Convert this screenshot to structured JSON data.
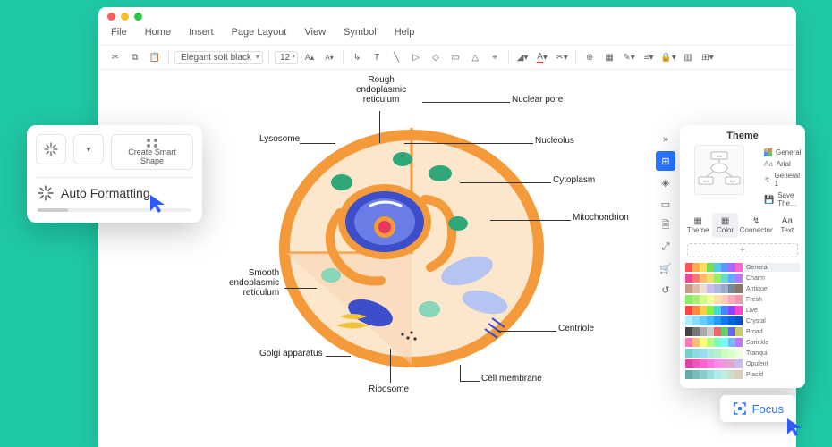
{
  "window": {
    "dots": [
      "#ff5f57",
      "#febc2e",
      "#28c840"
    ]
  },
  "menu": [
    "File",
    "Home",
    "Insert",
    "Page Layout",
    "View",
    "Symbol",
    "Help"
  ],
  "toolbar": {
    "font": "Elegant soft black",
    "size": "12"
  },
  "popover": {
    "create_smart_shape": "Create Smart\nShape",
    "auto_formatting": "Auto Formatting"
  },
  "theme": {
    "title": "Theme",
    "presets": [
      "General",
      "Arial",
      "General 1",
      "Save The…"
    ],
    "tabs": [
      "Theme",
      "Color",
      "Connector",
      "Text"
    ],
    "palettes": [
      "General",
      "Charm",
      "Antique",
      "Fresh",
      "Live",
      "Crystal",
      "Broad",
      "Sprinkle",
      "Tranquil",
      "Opulent",
      "Placid"
    ]
  },
  "labels": {
    "rough": "Rough\nendoplasmic\nreticulum",
    "lysosome": "Lysosome",
    "nuclear_pore": "Nuclear pore",
    "nucleolus": "Nucleolus",
    "cytoplasm": "Cytoplasm",
    "mitochondrion": "Mitochondrion",
    "centriole": "Centriole",
    "cell_membrane": "Cell membrane",
    "ribosome": "Ribosome",
    "golgi": "Golgi apparatus",
    "smooth": "Smooth\nendoplasmic\nreticulum"
  },
  "focus": {
    "label": "Focus"
  }
}
